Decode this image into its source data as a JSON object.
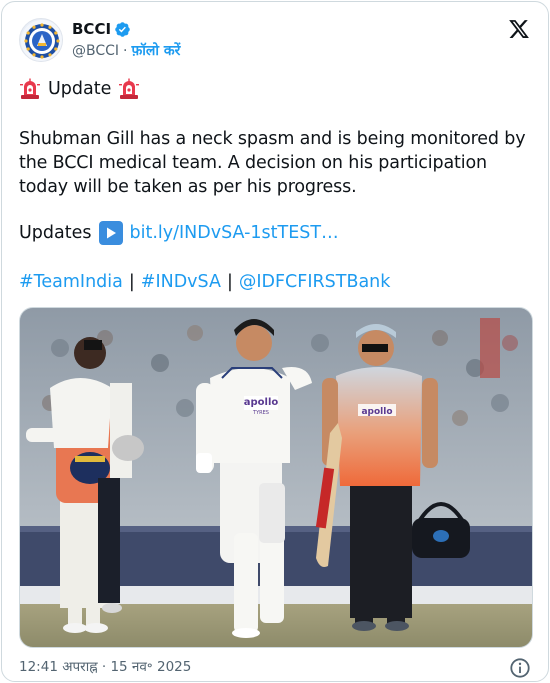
{
  "author": {
    "display_name": "BCCI",
    "handle": "@BCCI",
    "separator": "·",
    "follow_label": "फ़ॉलो करें"
  },
  "tweet": {
    "update_label": "Update",
    "paragraph": "Shubman Gill has a neck spasm and is being monitored by the BCCI medical team. A decision on his participation today will be taken as per his progress.",
    "updates_label": "Updates",
    "link_text": "bit.ly/INDvSA-1stTEST…",
    "hashtag_1": "#TeamIndia",
    "hashtag_2": "#INDvSA",
    "mention": "@IDFCFIRSTBank",
    "divider": "|"
  },
  "photo": {
    "jersey_sponsor": "apollo",
    "jersey_sponsor_sub": "TYRES"
  },
  "footer": {
    "timestamp": "12:41 अपराह्न · 15 नव॰ 2025"
  },
  "colors": {
    "link_blue": "#1d9bf0",
    "verified_blue": "#1d9bf0",
    "text_primary": "#0f1419",
    "text_secondary": "#536471"
  },
  "icons": {
    "verified": "verified-badge-icon",
    "x_logo": "x-logo-icon",
    "siren": "police-light-emoji-icon",
    "play": "play-button-emoji-icon",
    "info": "info-icon"
  }
}
